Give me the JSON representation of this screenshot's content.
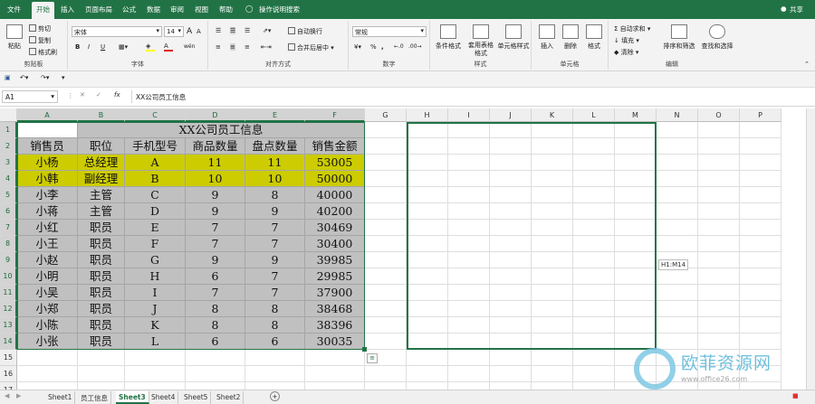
{
  "tabs": [
    "文件",
    "开始",
    "插入",
    "页面布局",
    "公式",
    "数据",
    "审阅",
    "视图",
    "帮助"
  ],
  "active_tab": "开始",
  "tell_me": "操作说明搜索",
  "share": "共享",
  "ribbon": {
    "clipboard": {
      "paste": "粘贴",
      "cut": "剪切",
      "copy": "复制",
      "painter": "格式刷",
      "label": "剪贴板"
    },
    "font": {
      "name": "宋体",
      "size": "14",
      "label": "字体",
      "bold": "B",
      "italic": "I",
      "underline": "U",
      "grow": "A",
      "shrink": "A",
      "font_color": "A",
      "wen": "wén"
    },
    "align": {
      "wrap": "自动换行",
      "merge": "合并后居中",
      "label": "对齐方式"
    },
    "number": {
      "format": "常规",
      "label": "数字",
      "pct": "%",
      "comma": ","
    },
    "styles": {
      "cond": "条件格式",
      "table": "套用表格格式",
      "cell": "单元格样式",
      "label": "样式"
    },
    "cells": {
      "insert": "插入",
      "delete": "删除",
      "format": "格式",
      "label": "单元格"
    },
    "editing": {
      "autosum": "自动求和",
      "fill": "填充",
      "clear": "清除",
      "sort": "排序和筛选",
      "find": "查找和选择",
      "label": "编辑"
    }
  },
  "name_box": "A1",
  "formula": "XX公司员工信息",
  "fx": "fx",
  "columns": [
    "A",
    "B",
    "C",
    "D",
    "E",
    "F",
    "G",
    "H",
    "I",
    "J",
    "K",
    "L",
    "M",
    "N",
    "O",
    "P"
  ],
  "rows": [
    "1",
    "2",
    "3",
    "4",
    "5",
    "6",
    "7",
    "8",
    "9",
    "10",
    "11",
    "12",
    "13",
    "14",
    "15",
    "16",
    "17"
  ],
  "sheet": {
    "title": "XX公司员工信息",
    "headers": [
      "销售员",
      "职位",
      "手机型号",
      "商品数量",
      "盘点数量",
      "销售金额"
    ],
    "data": [
      [
        "小杨",
        "总经理",
        "A",
        "11",
        "11",
        "53005"
      ],
      [
        "小韩",
        "副经理",
        "B",
        "10",
        "10",
        "50000"
      ],
      [
        "小李",
        "主管",
        "C",
        "9",
        "8",
        "40000"
      ],
      [
        "小蒋",
        "主管",
        "D",
        "9",
        "9",
        "40200"
      ],
      [
        "小红",
        "职员",
        "E",
        "7",
        "7",
        "30469"
      ],
      [
        "小王",
        "职员",
        "F",
        "7",
        "7",
        "30400"
      ],
      [
        "小赵",
        "职员",
        "G",
        "9",
        "9",
        "39985"
      ],
      [
        "小明",
        "职员",
        "H",
        "6",
        "7",
        "29985"
      ],
      [
        "小吴",
        "职员",
        "I",
        "7",
        "7",
        "37900"
      ],
      [
        "小郑",
        "职员",
        "J",
        "8",
        "8",
        "38468"
      ],
      [
        "小陈",
        "职员",
        "K",
        "8",
        "8",
        "38396"
      ],
      [
        "小张",
        "职员",
        "L",
        "6",
        "6",
        "30035"
      ]
    ],
    "highlight_color": "#cccc00",
    "fill_color": "#c0c0c0"
  },
  "selection_tooltip": "H1:M14",
  "sheet_tabs": [
    "Sheet1",
    "员工信息",
    "Sheet3",
    "Sheet4",
    "Sheet5",
    "Sheet2"
  ],
  "active_sheet": "Sheet3",
  "add_sheet": "+",
  "watermark": {
    "title": "欧菲资源网",
    "url": "www.office26.com"
  },
  "accent": "#217346"
}
